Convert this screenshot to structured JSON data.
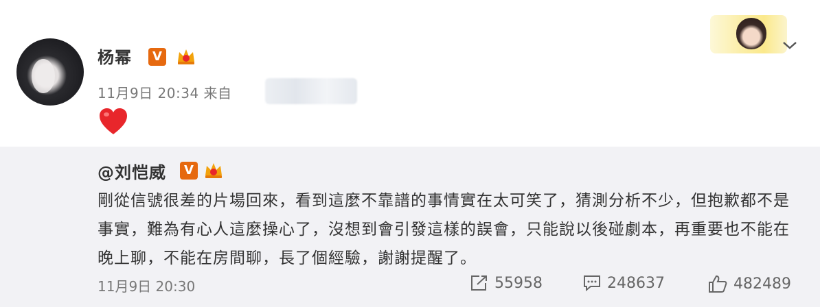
{
  "post": {
    "author": "杨幂",
    "verified_badge": "V",
    "date": "11月9日",
    "time": "20:34",
    "source_prefix": "来自",
    "icons": [
      "verified-badge-icon",
      "crown-icon",
      "heart-icon",
      "chevron-down-icon"
    ]
  },
  "repost": {
    "author": "@刘恺威",
    "verified_badge": "V",
    "text": "剛從信號很差的片場回來，看到這麼不靠譜的事情實在太可笑了，猜測分析不少，但抱歉都不是事實，難為有心人這麼操心了，沒想到會引發這樣的誤會，只能說以後碰劇本，再重要也不能在晚上聊，不能在房間聊，長了個經驗，謝謝提醒了。",
    "date": "11月9日",
    "time": "20:30",
    "reposts": "55958",
    "comments": "248637",
    "likes": "482489"
  },
  "colors": {
    "badge_orange": "#e6690f",
    "repost_bg": "#f2f2f5",
    "heart_red": "#e8262b"
  }
}
